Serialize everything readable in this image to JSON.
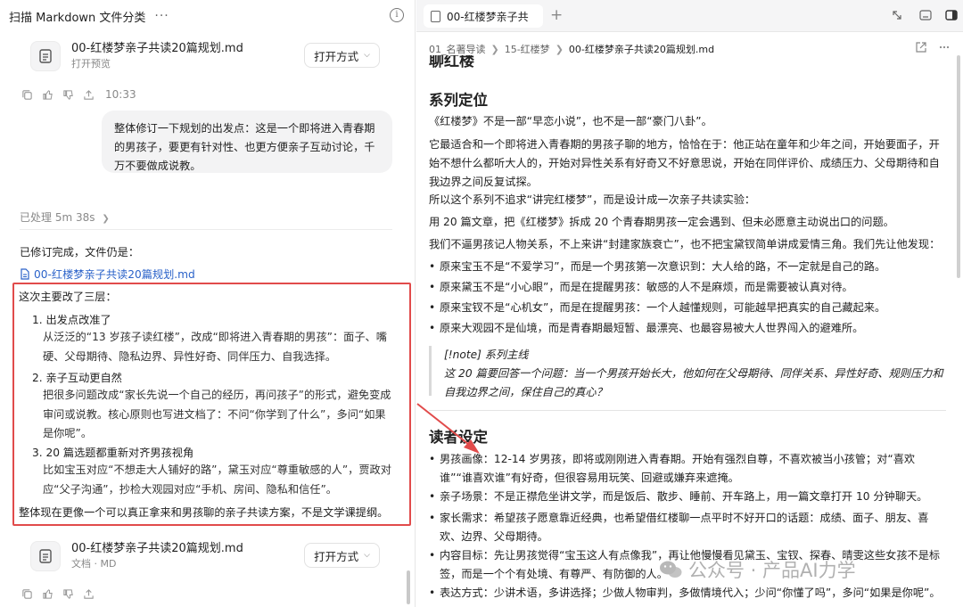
{
  "left": {
    "title": "扫描 Markdown 文件分类",
    "more": "···",
    "info": "i",
    "card_top": {
      "name": "00-红楼梦亲子共读20篇规划.md",
      "sub": "打开预览",
      "open_label": "打开方式"
    },
    "actions_time": "10:33",
    "user_message": "整体修订一下规划的出发点：这是一个即将进入青春期的男孩子，要更有针对性、也更方便亲子互动讨论，千万不要做成说教。",
    "processed": "已处理 5m 38s",
    "done_text": "已修订完成，文件仍是：",
    "file_link": "00-红楼梦亲子共读20篇规划.md",
    "summary_intro": "这次主要改了三层：",
    "changes": [
      {
        "title": "1. 出发点改准了",
        "body": "从泛泛的“13 岁孩子读红楼”，改成“即将进入青春期的男孩”：面子、嘴硬、父母期待、隐私边界、异性好奇、同伴压力、自我选择。"
      },
      {
        "title": "2. 亲子互动更自然",
        "body": "把很多问题改成“家长先说一个自己的经历，再问孩子”的形式，避免变成审问或说教。核心原则也写进文档了：不问“你学到了什么”，多问“如果是你呢”。"
      },
      {
        "title": "3. 20 篇选题都重新对齐男孩视角",
        "body": "比如宝玉对应“不想走大人铺好的路”，黛玉对应“尊重敏感的人”，贾政对应“父子沟通”，抄检大观园对应“手机、房间、隐私和信任”。"
      }
    ],
    "summary_outro": "整体现在更像一个可以真正拿来和男孩聊的亲子共读方案，不是文学课提纲。",
    "card_bottom": {
      "name": "00-红楼梦亲子共读20篇规划.md",
      "sub": "文档 · MD",
      "open_label": "打开方式"
    }
  },
  "right": {
    "tab_label": "00-红楼梦亲子共",
    "breadcrumb": [
      "01_名著导读",
      "15-红楼梦",
      "00-红楼梦亲子共读20篇规划.md"
    ],
    "partial_heading": "聊红楼",
    "section1": {
      "heading": "系列定位",
      "p1": "《红楼梦》不是一部“早恋小说”，也不是一部“豪门八卦”。",
      "p2": "它最适合和一个即将进入青春期的男孩子聊的地方，恰恰在于：他正站在童年和少年之间，开始要面子，开始不想什么都听大人的，开始对异性关系有好奇又不好意思说，开始在同伴评价、成绩压力、父母期待和自我边界之间反复试探。",
      "p3": "所以这个系列不追求“讲完红楼梦”，而是设计成一次亲子共读实验：",
      "p4": "用 20 篇文章，把《红楼梦》拆成 20 个青春期男孩一定会遇到、但未必愿意主动说出口的问题。",
      "p5": "我们不逼男孩记人物关系，不上来讲“封建家族衰亡”，也不把宝黛钗简单讲成爱情三角。我们先让他发现：",
      "bullets": [
        "原来宝玉不是“不爱学习”，而是一个男孩第一次意识到：大人给的路，不一定就是自己的路。",
        "原来黛玉不是“小心眼”，而是在提醒男孩：敏感的人不是麻烦，而是需要被认真对待。",
        "原来宝钗不是“心机女”，而是在提醒男孩：一个人越懂规则，可能越早把真实的自己藏起来。",
        "原来大观园不是仙境，而是青春期最短暂、最漂亮、也最容易被大人世界闯入的避难所。"
      ],
      "note_title": "[!note] 系列主线",
      "note_body": "这 20 篇要回答一个问题：当一个男孩开始长大，他如何在父母期待、同伴关系、异性好奇、规则压力和自我边界之间，保住自己的真心？"
    },
    "section2": {
      "heading": "读者设定",
      "bullets": [
        "男孩画像：12-14 岁男孩，即将或刚刚进入青春期。开始有强烈自尊，不喜欢被当小孩管；对“喜欢谁”“谁喜欢谁”有好奇，但很容易用玩笑、回避或嫌弃来遮掩。",
        "亲子场景：不是正襟危坐讲文学，而是饭后、散步、睡前、开车路上，用一篇文章打开 10 分钟聊天。",
        "家长需求：希望孩子愿意靠近经典，也希望借红楼聊一点平时不好开口的话题：成绩、面子、朋友、喜欢、边界、父母期待。",
        "内容目标：先让男孩觉得“宝玉这人有点像我”，再让他慢慢看见黛玉、宝钗、探春、晴雯这些女孩不是标签，而是一个个有处境、有尊严、有防御的人。",
        "表达方式：少讲术语，多讲选择；少做人物审判，多做情境代入；少问“你懂了吗”，多问“如果是你呢”。"
      ]
    },
    "watermark": "公众号 · 产品AI力学"
  }
}
